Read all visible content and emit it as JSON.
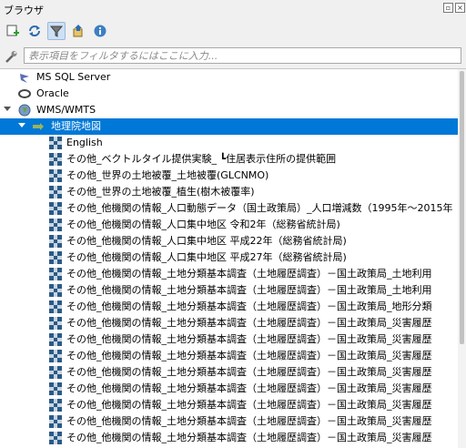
{
  "panel": {
    "title": "ブラウザ"
  },
  "filter": {
    "placeholder": "表示項目をフィルタするにはここに入力..."
  },
  "colors": {
    "selection": "#0078d7",
    "tile_icon": "#2a5a86"
  },
  "tree": {
    "providers": [
      {
        "label": "MS SQL Server",
        "icon": "mssql-icon"
      },
      {
        "label": "Oracle",
        "icon": "oracle-icon"
      },
      {
        "label": "WMS/WMTS",
        "icon": "wms-globe-icon"
      }
    ],
    "selected_node": {
      "label": "地理院地図",
      "icon": "wms-connection-icon"
    },
    "layers": [
      "English",
      "その他_ベクトルタイル提供実験_ ┗住居表示住所の提供範囲",
      "その他_世界の土地被覆_土地被覆(GLCNMO)",
      "その他_世界の土地被覆_植生(樹木被覆率)",
      "その他_他機関の情報_人口動態データ（国土政策局）_人口増減数（1995年〜2015年",
      "その他_他機関の情報_人口集中地区 令和2年（総務省統計局)",
      "その他_他機関の情報_人口集中地区 平成22年（総務省統計局)",
      "その他_他機関の情報_人口集中地区 平成27年（総務省統計局)",
      "その他_他機関の情報_土地分類基本調査（土地履歴調査）－国土政策局_土地利用",
      "その他_他機関の情報_土地分類基本調査（土地履歴調査）－国土政策局_土地利用",
      "その他_他機関の情報_土地分類基本調査（土地履歴調査）－国土政策局_地形分類",
      "その他_他機関の情報_土地分類基本調査（土地履歴調査）－国土政策局_災害履歴",
      "その他_他機関の情報_土地分類基本調査（土地履歴調査）－国土政策局_災害履歴",
      "その他_他機関の情報_土地分類基本調査（土地履歴調査）－国土政策局_災害履歴",
      "その他_他機関の情報_土地分類基本調査（土地履歴調査）－国土政策局_災害履歴",
      "その他_他機関の情報_土地分類基本調査（土地履歴調査）－国土政策局_災害履歴",
      "その他_他機関の情報_土地分類基本調査（土地履歴調査）－国土政策局_災害履歴",
      "その他_他機関の情報_土地分類基本調査（土地履歴調査）－国土政策局_災害履歴",
      "その他_他機関の情報_土地分類基本調査（土地履歴調査）－国土政策局_災害履歴"
    ]
  }
}
